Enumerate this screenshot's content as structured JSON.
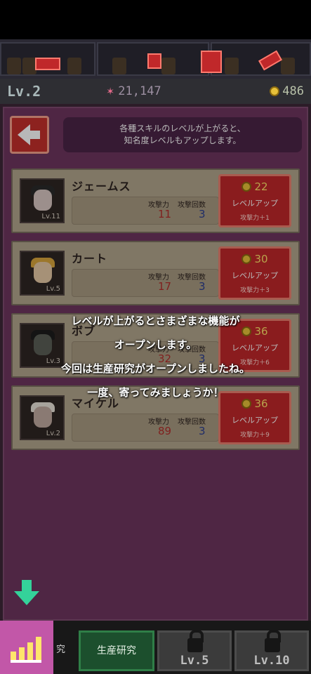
{
  "header": {
    "level": "Lv.2",
    "fans": "21,147",
    "coins": "486"
  },
  "hint": {
    "line1": "各種スキルのレベルが上がると、",
    "line2": "知名度レベルもアップします。"
  },
  "columns": {
    "attack": "攻撃力",
    "hits": "攻撃回数"
  },
  "upgrade_label": "レベルアップ",
  "characters": [
    {
      "name": "ジェームス",
      "level": "Lv.11",
      "attack": "11",
      "hits": "3",
      "cost": "22",
      "bonus": "攻撃力＋1"
    },
    {
      "name": "カート",
      "level": "Lv.5",
      "attack": "17",
      "hits": "3",
      "cost": "30",
      "bonus": "攻撃力＋3"
    },
    {
      "name": "ボブ",
      "level": "Lv.3",
      "attack": "32",
      "hits": "3",
      "cost": "36",
      "bonus": "攻撃力＋6"
    },
    {
      "name": "マイケル",
      "level": "Lv.2",
      "attack": "89",
      "hits": "3",
      "cost": "36",
      "bonus": "攻撃力＋9"
    }
  ],
  "overlay": {
    "line1": "レベルが上がるとさまざまな機能が",
    "line2": "オープンします。",
    "line3": "今回は生産研究がオープンしましたね。",
    "line4": "一度、寄ってみましょうか！"
  },
  "nav": {
    "cut_label": "究",
    "production": "生産研究",
    "lock1": "Lv.5",
    "lock2": "Lv.10"
  },
  "colors": {
    "panel": "#6e355f",
    "button_red": "#c0282a",
    "active_tab": "#c257a8",
    "production_tab": "#1c4f2d"
  }
}
